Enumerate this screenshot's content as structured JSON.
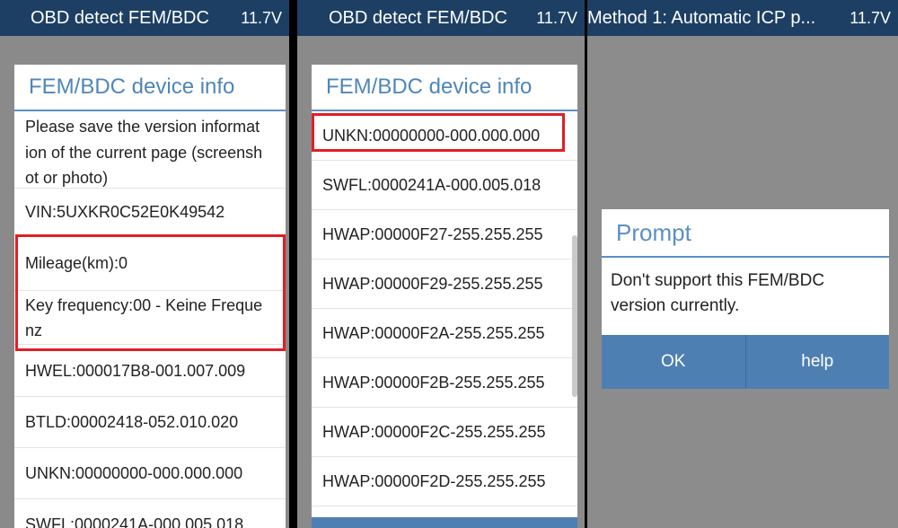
{
  "panel1": {
    "title": "OBD detect FEM/BDC",
    "voltage": "11.7V",
    "card_title": "FEM/BDC device info",
    "rows": [
      "Please save the version informat\nion of the current page (screensh\not or photo)",
      "VIN:5UXKR0C52E0K49542",
      "Mileage(km):0",
      "Key frequency:00 - Keine Freque\nnz",
      "HWEL:000017B8-001.007.009",
      "BTLD:00002418-052.010.020",
      "UNKN:00000000-000.000.000",
      "SWFL:0000241A-000.005.018"
    ]
  },
  "panel2": {
    "title": "OBD detect FEM/BDC",
    "voltage": "11.7V",
    "card_title": "FEM/BDC device info",
    "rows": [
      "UNKN:00000000-000.000.000",
      "SWFL:0000241A-000.005.018",
      "HWAP:00000F27-255.255.255",
      "HWAP:00000F29-255.255.255",
      "HWAP:00000F2A-255.255.255",
      "HWAP:00000F2B-255.255.255",
      "HWAP:00000F2C-255.255.255",
      "HWAP:00000F2D-255.255.255"
    ]
  },
  "panel3": {
    "title": "Method 1: Automatic ICP p...",
    "voltage": "11.7V",
    "dialog": {
      "title": "Prompt",
      "message": "Don't support this FEM/BDC version currently.",
      "ok_label": "OK",
      "help_label": "help"
    }
  },
  "colors": {
    "title_bar": "#1d3f63",
    "accent": "#5b8fc4",
    "highlight": "#e01f26",
    "background": "#8a8a8a"
  }
}
